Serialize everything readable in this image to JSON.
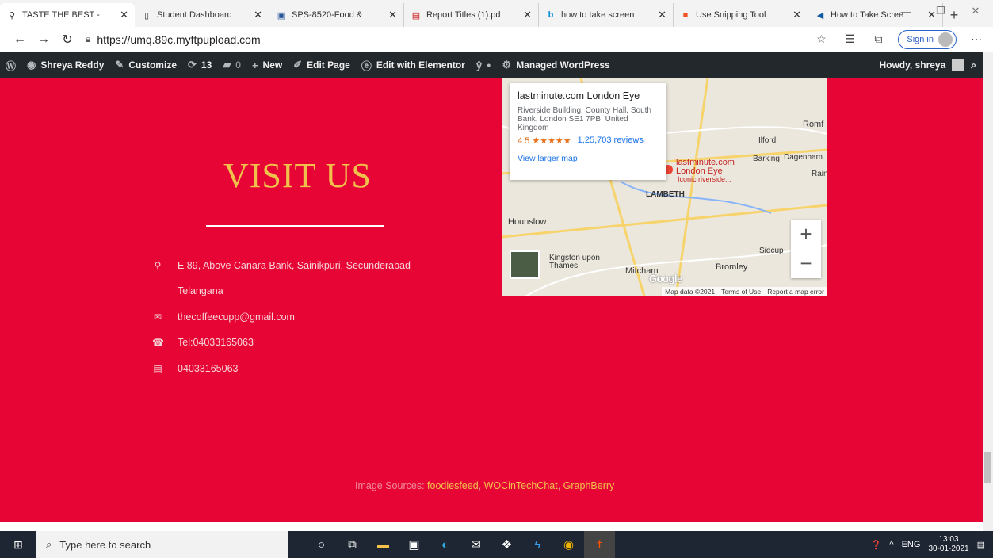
{
  "browser": {
    "tabs": [
      {
        "title": "TASTE THE BEST -",
        "icon": "location-pin-icon",
        "active": true
      },
      {
        "title": "Student Dashboard",
        "icon": "document-icon"
      },
      {
        "title": "SPS-8520-Food &",
        "icon": "edit-doc-icon"
      },
      {
        "title": "Report Titles (1).pd",
        "icon": "pdf-icon"
      },
      {
        "title": "how to take screen",
        "icon": "bing-icon"
      },
      {
        "title": "Use Snipping Tool",
        "icon": "microsoft-icon"
      },
      {
        "title": "How to Take Scree",
        "icon": "edge-icon"
      }
    ],
    "url": "https://umq.89c.myftpupload.com",
    "signin_label": "Sign in"
  },
  "adminbar": {
    "site_name": "Shreya Reddy",
    "customize": "Customize",
    "updates_count": "13",
    "comments_count": "0",
    "new_label": "New",
    "edit_page": "Edit Page",
    "elementor": "Edit with Elementor",
    "managed": "Managed WordPress",
    "howdy": "Howdy, shreya"
  },
  "page": {
    "heading": "VISIT US",
    "address": "E 89, Above Canara Bank, Sainikpuri, Secunderabad",
    "state": "Telangana",
    "email": "thecoffeecupp@gmail.com",
    "tel": "Tel:04033165063",
    "fax": "04033165063",
    "credits_prefix": "Image Sources:",
    "credit_1": "foodiesfeed",
    "credit_2": "WOCinTechChat",
    "credit_3": "GraphBerry"
  },
  "map": {
    "place_name": "lastminute.com London Eye",
    "place_address": "Riverside Building, County Hall, South Bank, London SE1 7PB, United Kingdom",
    "rating": "4.5 ★★★★★",
    "reviews": "1,25,703 reviews",
    "larger_map": "View larger map",
    "pin_label_1": "lastminute.com",
    "pin_label_2": "London Eye",
    "pin_label_3": "Iconic riverside...",
    "labels": [
      "Romf",
      "Ilford",
      "Barking",
      "Dagenham",
      "Rain",
      "LAMBETH",
      "Hounslow",
      "Kingston upon Thames",
      "Mitcham",
      "Bromley",
      "Sidcup"
    ],
    "footer_data": "Map data ©2021",
    "footer_terms": "Terms of Use",
    "footer_report": "Report a map error",
    "google": "Google"
  },
  "taskbar": {
    "search_placeholder": "Type here to search",
    "lang": "ENG",
    "time": "13:03",
    "date": "30-01-2021"
  }
}
